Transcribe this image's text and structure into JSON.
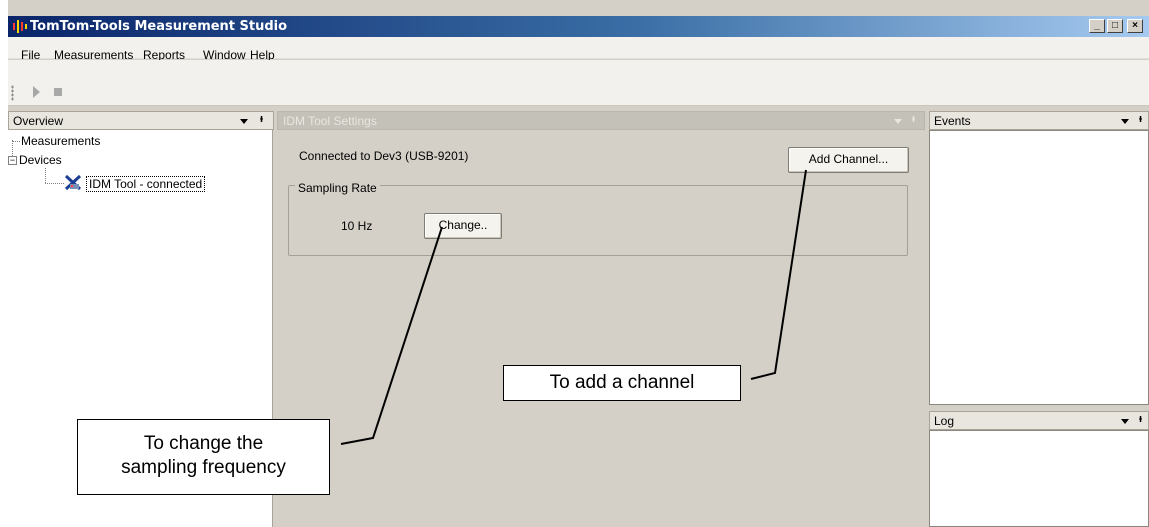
{
  "window": {
    "title": "TomTom-Tools Measurement Studio",
    "buttons": [
      "_",
      "□",
      "×"
    ]
  },
  "menu": [
    "File",
    "Measurements",
    "Reports",
    "Window",
    "Help"
  ],
  "toolbar": {
    "icons": [
      "play-icon",
      "stop-icon"
    ]
  },
  "overview": {
    "title": "Overview",
    "tree": {
      "measurements": "Measurements",
      "devices": "Devices",
      "device": "IDM Tool - connected",
      "expander": "−"
    }
  },
  "settings": {
    "title": "IDM Tool Settings",
    "connected": "Connected to Dev3 (USB-9201)",
    "add_channel": "Add Channel...",
    "sampling_group": "Sampling Rate",
    "rate": "10 Hz",
    "change": "Change.."
  },
  "events": {
    "title": "Events"
  },
  "log": {
    "title": "Log"
  },
  "annotations": {
    "add_channel": "To add a channel",
    "change_line1": "To change the",
    "change_line2": "sampling frequency"
  },
  "glyphs": {
    "pin": "ᵻ"
  }
}
